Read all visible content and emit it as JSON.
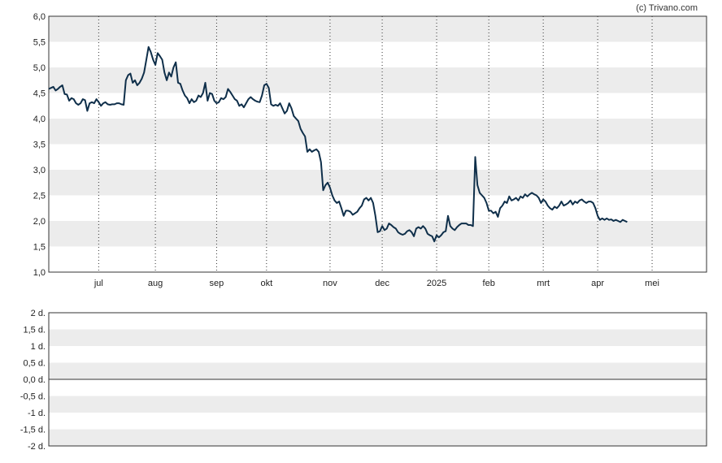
{
  "credit": "(c) Trivano.com",
  "colors": {
    "line": "#0f2f4a",
    "band": "#ececec",
    "background": "#ffffff",
    "frame": "#333333",
    "vgrid": "#333333"
  },
  "chart_data": [
    {
      "type": "line",
      "title": "",
      "xlabel": "",
      "ylabel": "",
      "ylim": [
        1.0,
        6.0
      ],
      "y_ticks": [
        "1,0",
        "1,5",
        "2,0",
        "2,5",
        "3,0",
        "3,5",
        "4,0",
        "4,5",
        "5,0",
        "5,5",
        "6,0"
      ],
      "x_ticks": [
        "jul",
        "aug",
        "sep",
        "okt",
        "nov",
        "dec",
        "2025",
        "feb",
        "mrt",
        "apr",
        "mei"
      ],
      "grid": true,
      "x_index_range": [
        0,
        290
      ],
      "x_tick_index": [
        22,
        47,
        74,
        96,
        124,
        147,
        171,
        194,
        218,
        242,
        266
      ],
      "values": [
        4.58,
        4.6,
        4.62,
        4.55,
        4.58,
        4.62,
        4.65,
        4.48,
        4.47,
        4.35,
        4.4,
        4.38,
        4.3,
        4.27,
        4.3,
        4.38,
        4.36,
        4.15,
        4.3,
        4.32,
        4.3,
        4.38,
        4.32,
        4.25,
        4.3,
        4.32,
        4.28,
        4.27,
        4.28,
        4.28,
        4.3,
        4.3,
        4.28,
        4.27,
        4.75,
        4.85,
        4.88,
        4.7,
        4.75,
        4.65,
        4.7,
        4.78,
        4.9,
        5.15,
        5.4,
        5.3,
        5.15,
        5.05,
        5.28,
        5.22,
        5.15,
        4.9,
        4.75,
        4.9,
        4.82,
        5.0,
        5.1,
        4.7,
        4.68,
        4.55,
        4.45,
        4.4,
        4.3,
        4.38,
        4.32,
        4.35,
        4.45,
        4.42,
        4.5,
        4.7,
        4.35,
        4.5,
        4.48,
        4.35,
        4.3,
        4.32,
        4.4,
        4.38,
        4.42,
        4.58,
        4.52,
        4.45,
        4.38,
        4.35,
        4.25,
        4.28,
        4.22,
        4.3,
        4.38,
        4.42,
        4.38,
        4.35,
        4.33,
        4.32,
        4.45,
        4.65,
        4.68,
        4.6,
        4.28,
        4.25,
        4.27,
        4.25,
        4.3,
        4.2,
        4.1,
        4.15,
        4.3,
        4.2,
        4.05,
        4.0,
        3.95,
        3.8,
        3.72,
        3.65,
        3.35,
        3.4,
        3.35,
        3.38,
        3.4,
        3.35,
        3.15,
        2.6,
        2.7,
        2.75,
        2.65,
        2.5,
        2.4,
        2.35,
        2.38,
        2.25,
        2.1,
        2.2,
        2.2,
        2.18,
        2.12,
        2.15,
        2.18,
        2.25,
        2.3,
        2.42,
        2.45,
        2.4,
        2.45,
        2.35,
        2.1,
        1.78,
        1.8,
        1.9,
        1.82,
        1.85,
        1.95,
        1.92,
        1.88,
        1.85,
        1.78,
        1.75,
        1.73,
        1.75,
        1.8,
        1.82,
        1.78,
        1.7,
        1.85,
        1.88,
        1.85,
        1.9,
        1.85,
        1.75,
        1.72,
        1.7,
        1.6,
        1.72,
        1.68,
        1.72,
        1.78,
        1.8,
        2.1,
        1.9,
        1.85,
        1.82,
        1.88,
        1.92,
        1.95,
        1.95,
        1.95,
        1.92,
        1.92,
        1.9,
        3.25,
        2.7,
        2.55,
        2.5,
        2.45,
        2.35,
        2.2,
        2.2,
        2.15,
        2.18,
        2.08,
        2.25,
        2.3,
        2.38,
        2.35,
        2.48,
        2.4,
        2.42,
        2.45,
        2.4,
        2.48,
        2.45,
        2.52,
        2.48,
        2.52,
        2.55,
        2.52,
        2.5,
        2.45,
        2.35,
        2.42,
        2.38,
        2.3,
        2.25,
        2.22,
        2.28,
        2.25,
        2.3,
        2.38,
        2.3,
        2.32,
        2.35,
        2.4,
        2.32,
        2.38,
        2.35,
        2.4,
        2.42,
        2.38,
        2.35,
        2.38,
        2.38,
        2.35,
        2.25,
        2.1,
        2.02,
        2.05,
        2.02,
        2.05,
        2.02,
        2.03,
        2.0,
        2.02,
        2.0,
        1.98,
        2.02,
        2.0,
        1.98
      ]
    },
    {
      "type": "bar",
      "title": "",
      "xlabel": "",
      "ylabel": "",
      "ylim": [
        -2,
        2
      ],
      "y_ticks": [
        "-2 d.",
        "-1,5 d.",
        "-1 d.",
        "-0,5 d.",
        "0,0 d.",
        "0,5 d.",
        "1 d.",
        "1,5 d.",
        "2 d."
      ],
      "values": []
    }
  ]
}
